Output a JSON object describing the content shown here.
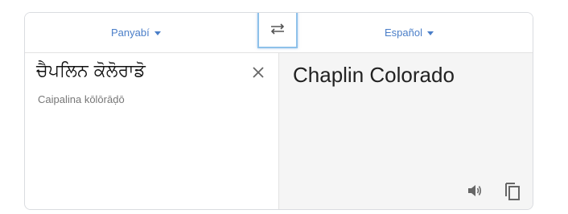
{
  "source_language": {
    "label": "Panyabí"
  },
  "target_language": {
    "label": "Español"
  },
  "source": {
    "text": "ਚੈਪਲਿਨ ਕੋਲੋਰਾਡੋ",
    "transliteration": "Caipalina kōlōrāḍō"
  },
  "target": {
    "text": "Chaplin Colorado"
  },
  "colors": {
    "accent": "#4a7ec8",
    "focus_border": "#8ec1ea",
    "target_bg": "#f5f5f5"
  },
  "icons": {
    "swap": "swap-arrows-icon",
    "clear": "close-icon",
    "listen": "speaker-icon",
    "copy": "copy-icon"
  }
}
